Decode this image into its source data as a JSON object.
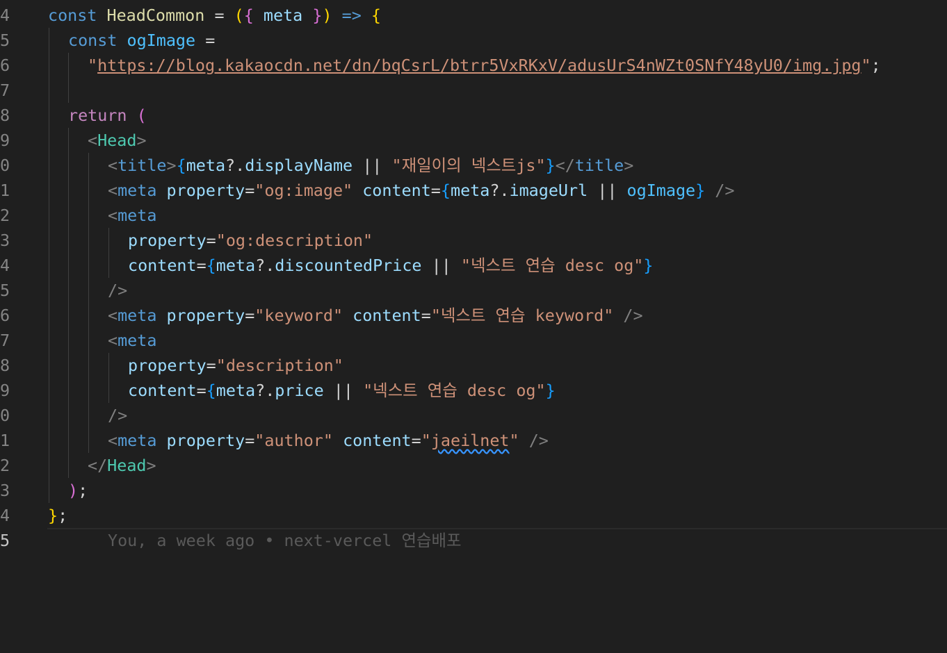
{
  "editor": {
    "lines": [
      {
        "num": "4",
        "text": "const HeadCommon = ({ meta }) => {"
      },
      {
        "num": "5",
        "text": "const ogImage ="
      },
      {
        "num": "6",
        "text": "\"https://blog.kakaocdn.net/dn/bqCsrL/btrr5VxRKxV/adusUrS4nWZt0SNfY48yU0/img.jpg\";"
      },
      {
        "num": "7",
        "text": ""
      },
      {
        "num": "8",
        "text": "return ("
      },
      {
        "num": "9",
        "text": "<Head>"
      },
      {
        "num": "0",
        "text": "<title>{meta?.displayName || \"재일이의 넥스트js\"}</title>"
      },
      {
        "num": "1",
        "text": "<meta property=\"og:image\" content={meta?.imageUrl || ogImage} />"
      },
      {
        "num": "2",
        "text": "<meta"
      },
      {
        "num": "3",
        "text": "property=\"og:description\""
      },
      {
        "num": "4",
        "text": "content={meta?.discountedPrice || \"넥스트 연습 desc og\"}"
      },
      {
        "num": "5",
        "text": "/>"
      },
      {
        "num": "6",
        "text": "<meta property=\"keyword\" content=\"넥스트 연습 keyword\" />"
      },
      {
        "num": "7",
        "text": "<meta"
      },
      {
        "num": "8",
        "text": "property=\"description\""
      },
      {
        "num": "9",
        "text": "content={meta?.price || \"넥스트 연습 desc og\"}"
      },
      {
        "num": "0",
        "text": "/>"
      },
      {
        "num": "1",
        "text": "<meta property=\"author\" content=\"jaeilnet\" />"
      },
      {
        "num": "2",
        "text": "</Head>"
      },
      {
        "num": "3",
        "text": ");"
      },
      {
        "num": "4",
        "text": "};"
      },
      {
        "num": "5",
        "text": ""
      }
    ],
    "blame": "You, a week ago • next-vercel 연습배포"
  },
  "theme": {
    "background": "#1f1f1f",
    "keyword": "#569cd6",
    "control": "#c586c0",
    "function": "#dcdcaa",
    "variable": "#9cdcfe",
    "constant": "#4fc1ff",
    "string": "#ce9178",
    "component": "#4ec9b0",
    "bracket_gold": "#ffd700",
    "bracket_purple": "#da70d6",
    "bracket_blue": "#179fff"
  }
}
